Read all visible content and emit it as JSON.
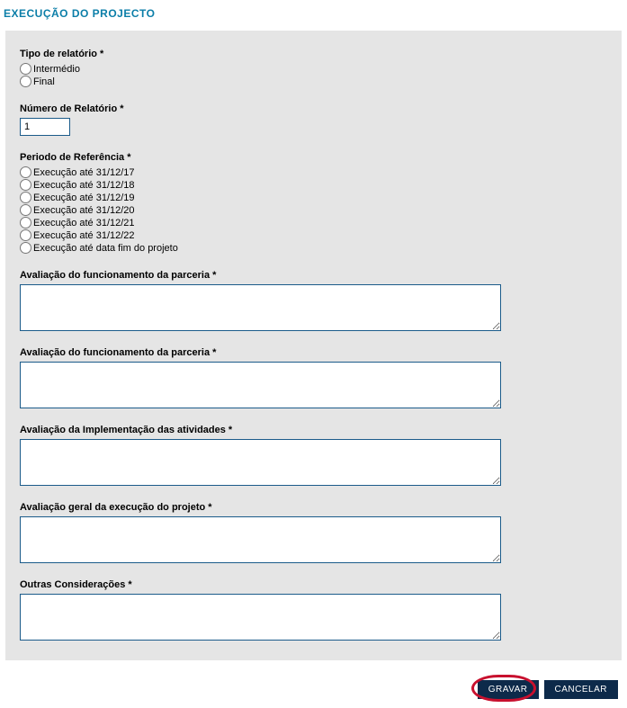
{
  "page_title": "EXECUÇÃO DO PROJECTO",
  "report_type": {
    "label": "Tipo de relatório *",
    "options": [
      {
        "label": "Intermédio"
      },
      {
        "label": "Final"
      }
    ]
  },
  "report_number": {
    "label": "Número de Relatório *",
    "value": "1"
  },
  "ref_period": {
    "label": "Periodo de Referência *",
    "options": [
      {
        "label": "Execução até 31/12/17"
      },
      {
        "label": "Execução até 31/12/18"
      },
      {
        "label": "Execução até 31/12/19"
      },
      {
        "label": "Execução até 31/12/20"
      },
      {
        "label": "Execução até 31/12/21"
      },
      {
        "label": "Execução até 31/12/22"
      },
      {
        "label": "Execução até data fim do projeto"
      }
    ]
  },
  "sections": {
    "aval_parceria1": {
      "label": "Avaliação do funcionamento da parceria *"
    },
    "aval_parceria2": {
      "label": "Avaliação do funcionamento da parceria *"
    },
    "aval_impl": {
      "label": "Avaliação da Implementação das atividades *"
    },
    "aval_geral": {
      "label": "Avaliação geral da execução do projeto *"
    },
    "outras": {
      "label": "Outras Considerações *"
    }
  },
  "buttons": {
    "save": "GRAVAR",
    "cancel": "CANCELAR"
  }
}
